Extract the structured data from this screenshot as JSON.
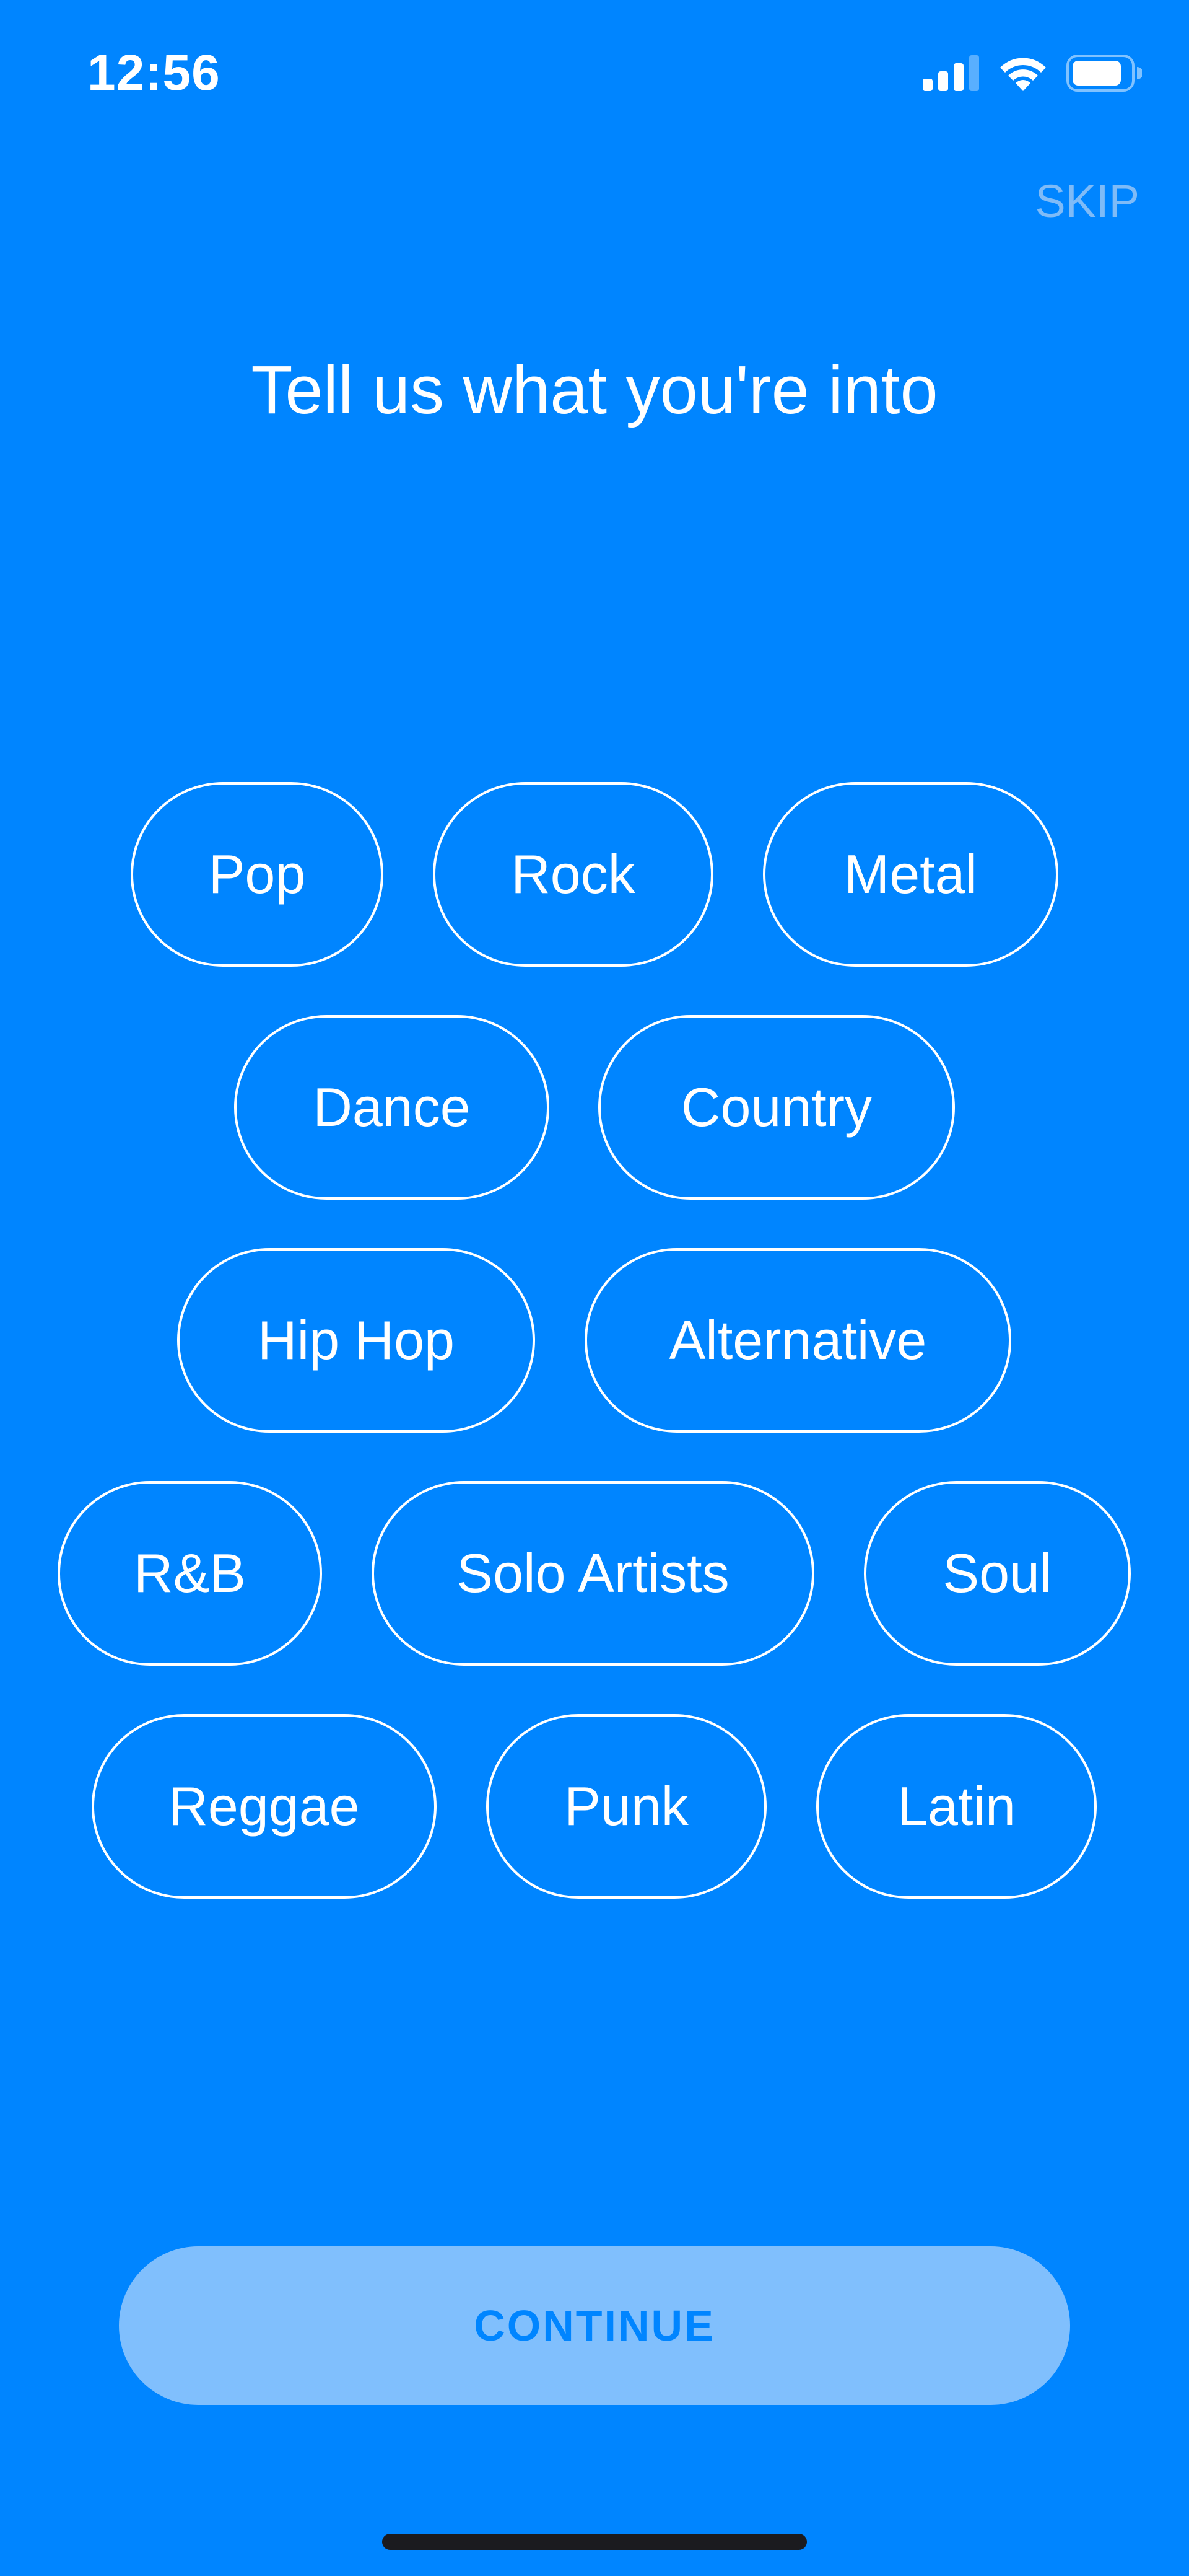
{
  "status_bar": {
    "time": "12:56",
    "icons": [
      "cellular-signal-icon",
      "wifi-icon",
      "battery-icon"
    ]
  },
  "header": {
    "skip_label": "SKIP",
    "title": "Tell us what you're into"
  },
  "genres": [
    "Pop",
    "Rock",
    "Metal",
    "Dance",
    "Country",
    "Hip Hop",
    "Alternative",
    "R&B",
    "Solo Artists",
    "Soul",
    "Reggae",
    "Punk",
    "Latin"
  ],
  "footer": {
    "continue_label": "CONTINUE"
  },
  "colors": {
    "background": "#0085FF",
    "chip_border": "#FFFFFF",
    "skip_text": "#7FBBF7",
    "continue_bg": "#80BFFD",
    "continue_text": "#0085FF"
  }
}
